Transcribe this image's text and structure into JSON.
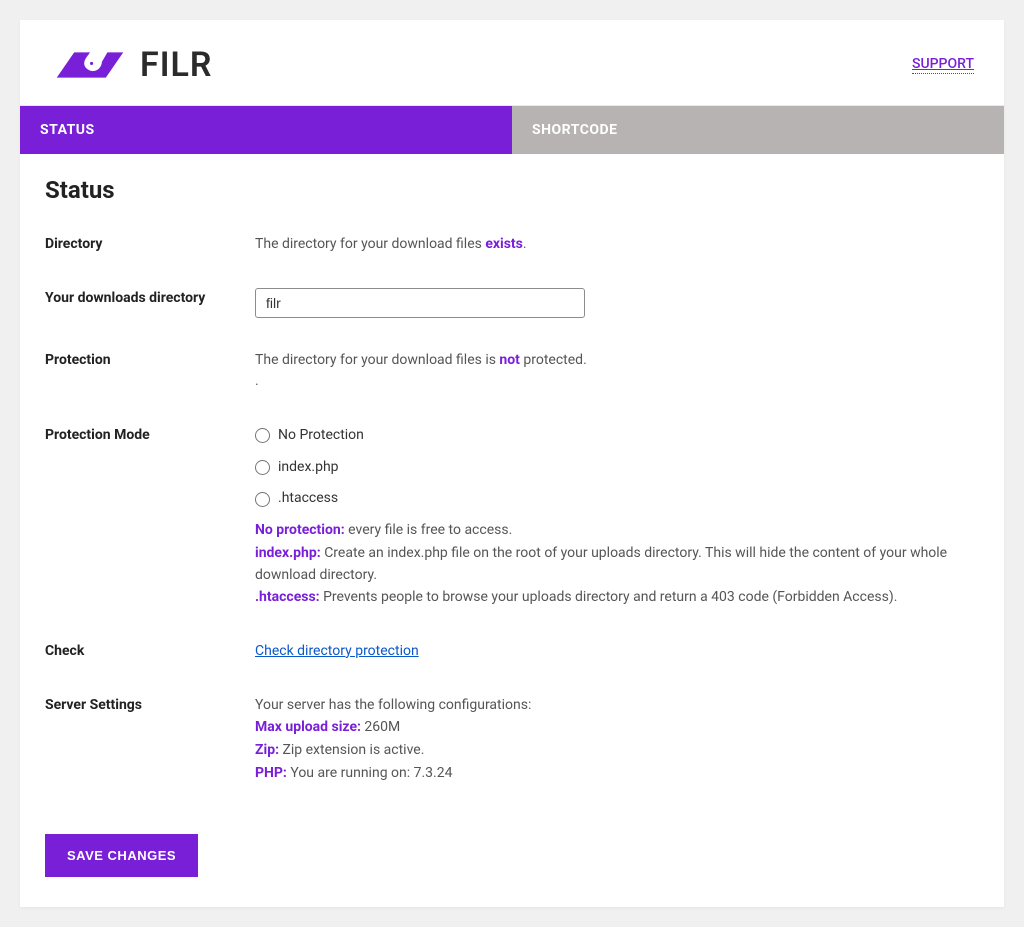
{
  "header": {
    "brand": "FILR",
    "support_label": "SUPPORT"
  },
  "tabs": {
    "status": "STATUS",
    "shortcode": "SHORTCODE"
  },
  "page": {
    "title": "Status"
  },
  "directory": {
    "label": "Directory",
    "text_before": "The directory for your download files ",
    "status_word": "exists",
    "text_after": "."
  },
  "downloads_dir": {
    "label": "Your downloads directory",
    "value": "filr"
  },
  "protection": {
    "label": "Protection",
    "text_before": "The directory for your download files is ",
    "status_word": "not",
    "text_after": " protected.",
    "trailing": "."
  },
  "protection_mode": {
    "label": "Protection Mode",
    "options": {
      "none": "No Protection",
      "index": "index.php",
      "htaccess": ".htaccess"
    },
    "desc_none_lead": "No protection:",
    "desc_none_text": " every file is free to access.",
    "desc_index_lead": "index.php:",
    "desc_index_text": " Create an index.php file on the root of your uploads directory. This will hide the content of your whole download directory.",
    "desc_htaccess_lead": ".htaccess:",
    "desc_htaccess_text": " Prevents people to browse your uploads directory and return a 403 code (Forbidden Access)."
  },
  "check": {
    "label": "Check",
    "link_text": "Check directory protection"
  },
  "server": {
    "label": "Server Settings",
    "intro": "Your server has the following configurations:",
    "max_upload_lead": "Max upload size:",
    "max_upload_val": " 260M",
    "zip_lead": "Zip:",
    "zip_val": " Zip extension is active.",
    "php_lead": "PHP:",
    "php_val": " You are running on: 7.3.24"
  },
  "actions": {
    "save": "SAVE CHANGES"
  }
}
